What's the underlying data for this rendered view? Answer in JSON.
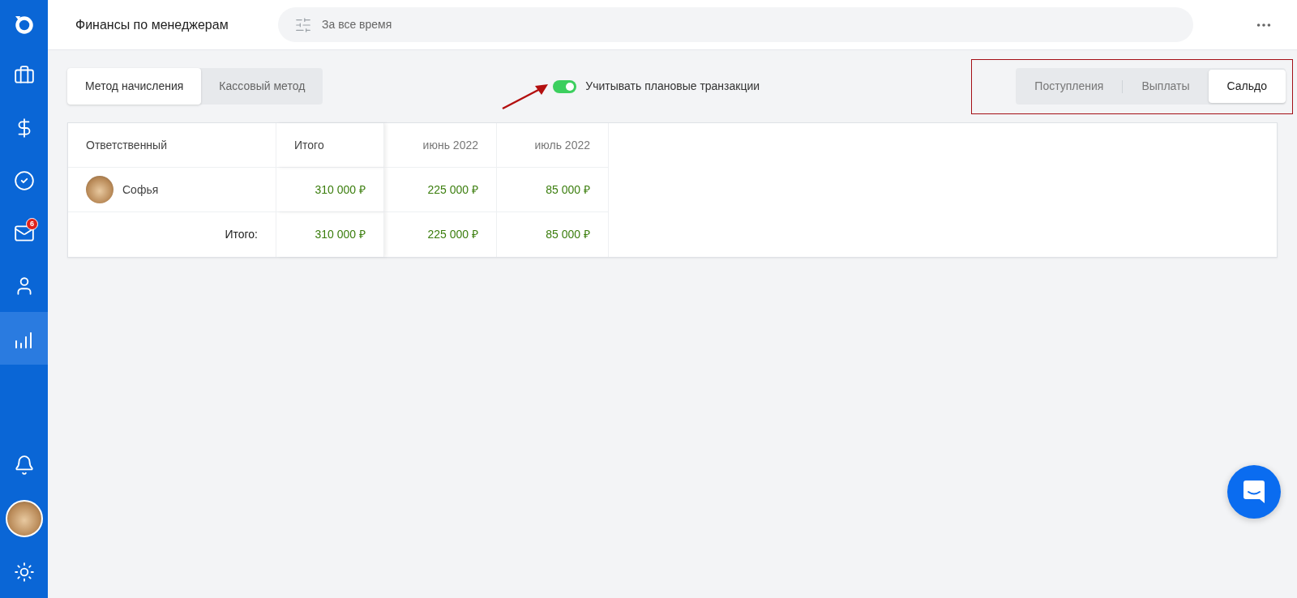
{
  "sidebar": {
    "items": [
      {
        "kind": "briefcase",
        "selected": false
      },
      {
        "kind": "dollar",
        "selected": false
      },
      {
        "kind": "check",
        "selected": false
      },
      {
        "kind": "mail",
        "selected": false,
        "badge": "6"
      },
      {
        "kind": "user",
        "selected": false
      },
      {
        "kind": "chart",
        "selected": true
      }
    ],
    "bottom_items": [
      {
        "kind": "bell"
      },
      {
        "kind": "avatar"
      },
      {
        "kind": "settings"
      }
    ]
  },
  "header": {
    "title": "Финансы по менеджерам",
    "filter": {
      "value": "За все время"
    }
  },
  "method_tabs": [
    {
      "label": "Метод начисления",
      "selected": true
    },
    {
      "label": "Кассовый метод",
      "selected": false
    }
  ],
  "planned_toggle": {
    "label": "Учитывать плановые транзакции",
    "on": true
  },
  "view_tabs": [
    {
      "label": "Поступления",
      "selected": false
    },
    {
      "label": "Выплаты",
      "selected": false
    },
    {
      "label": "Сальдо",
      "selected": true
    }
  ],
  "table": {
    "columns": [
      "Ответственный",
      "Итого",
      "июнь 2022",
      "июль 2022"
    ],
    "rows": [
      {
        "name": "Софья",
        "total": "310 000 ₽",
        "values": [
          "225 000 ₽",
          "85 000 ₽"
        ]
      }
    ],
    "footer": {
      "label": "Итого:",
      "total": "310 000 ₽",
      "values": [
        "225 000 ₽",
        "85 000 ₽"
      ]
    }
  }
}
